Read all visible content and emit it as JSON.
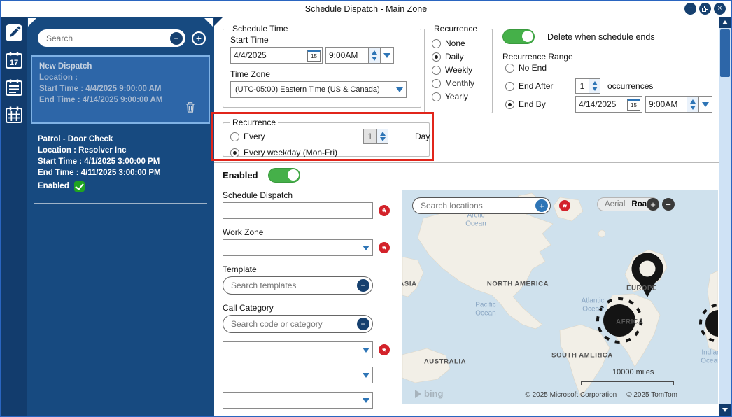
{
  "window": {
    "title": "Schedule Dispatch - Main Zone"
  },
  "titlebar": {
    "minimize_glyph": "−",
    "close_glyph": "×"
  },
  "glyphs": {
    "plus": "+",
    "minus": "−",
    "required": "*"
  },
  "sidebar": {
    "calendar_badge": "17"
  },
  "left_panel": {
    "search_placeholder": "Search",
    "items": [
      {
        "title": "New Dispatch",
        "location": "Location :",
        "start": "Start Time : 4/4/2025 9:00:00 AM",
        "end": "End Time : 4/14/2025 9:00:00 AM"
      },
      {
        "title": "Patrol - Door Check",
        "location": "Location : Resolver Inc",
        "start": "Start Time : 4/1/2025 3:00:00 PM",
        "end": "End Time : 4/11/2025 3:00:00 PM",
        "enabled_label": "Enabled"
      }
    ]
  },
  "schedule_time": {
    "legend": "Schedule Time",
    "start_time_label": "Start Time",
    "start_date": "4/4/2025",
    "start_time_value": "9:00AM",
    "calendar_day": "15",
    "time_zone_label": "Time Zone",
    "time_zone_value": "(UTC-05:00) Eastern Time (US & Canada)"
  },
  "recurrence_type": {
    "legend": "Recurrence",
    "options": [
      {
        "label": "None",
        "selected": false
      },
      {
        "label": "Daily",
        "selected": true
      },
      {
        "label": "Weekly",
        "selected": false
      },
      {
        "label": "Monthly",
        "selected": false
      },
      {
        "label": "Yearly",
        "selected": false
      }
    ]
  },
  "schedule_end": {
    "delete_toggle_label": "Delete when schedule ends",
    "delete_toggle_on": true,
    "range_label": "Recurrence Range",
    "no_end_label": "No End",
    "end_after_label": "End After",
    "occurrences_value": "1",
    "occurrences_label": "occurrences",
    "end_by_label": "End By",
    "end_by_selected": true,
    "end_by_date": "4/14/2025",
    "end_by_time": "9:00AM",
    "calendar_day": "15"
  },
  "recurrence_pattern": {
    "legend": "Recurrence",
    "every_label": "Every",
    "every_value": "1",
    "every_unit_label": "Day",
    "every_selected": false,
    "weekday_label": "Every weekday (Mon-Fri)",
    "weekday_selected": true
  },
  "dispatch_form": {
    "enabled_label": "Enabled",
    "enabled_on": true,
    "schedule_dispatch_label": "Schedule Dispatch",
    "work_zone_label": "Work Zone",
    "template_label": "Template",
    "template_placeholder": "Search templates",
    "call_category_label": "Call Category",
    "call_category_placeholder": "Search code or category"
  },
  "map": {
    "search_placeholder": "Search locations",
    "view_aerial_label": "Aerial",
    "view_road_label": "Road",
    "zoom_in_glyph": "+",
    "zoom_out_glyph": "−",
    "scale_label": "10000 miles",
    "copyright_left": "© 2025 Microsoft Corporation",
    "copyright_right": "© 2025 TomTom",
    "logo_text": "bing",
    "labels": {
      "arctic_ocean": "Arctic\nOcean",
      "asia": "ASIA",
      "north_america": "NORTH AMERICA",
      "pacific_ocean": "Pacific\nOcean",
      "atlantic_ocean": "Atlantic\nOcean",
      "europe": "EUROPE",
      "africa": "AFRICA",
      "south_america": "SOUTH AMERICA",
      "australia": "AUSTRALIA",
      "indian_ocean": "Indian\nOcean"
    }
  },
  "colors": {
    "accent_blue": "#2e75b6",
    "navy": "#16406f",
    "toggle_green": "#45b049",
    "required_red": "#d3222a",
    "highlight_red": "#e1251b"
  }
}
